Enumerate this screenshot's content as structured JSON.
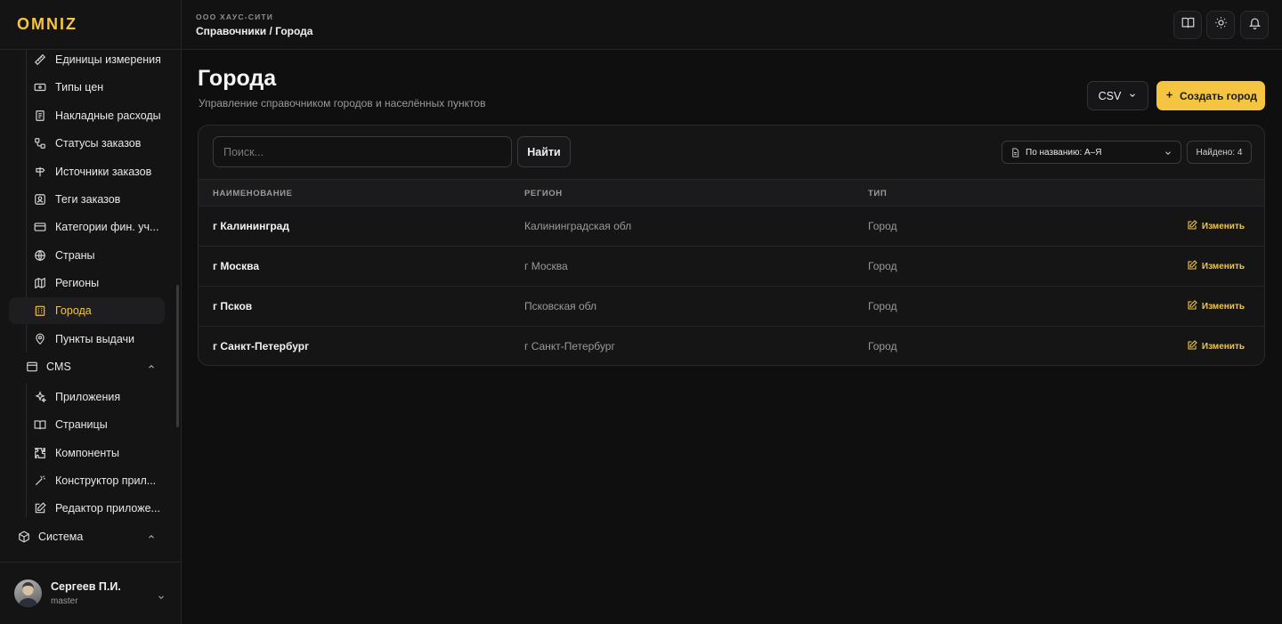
{
  "brand": {
    "logo_text": "OMNIZ",
    "accent": "#f5c542"
  },
  "sidebar": {
    "items": [
      {
        "label": "Единицы измерения",
        "icon": "ruler-icon"
      },
      {
        "label": "Типы цен",
        "icon": "banknote-icon"
      },
      {
        "label": "Накладные расходы",
        "icon": "receipt-icon"
      },
      {
        "label": "Статусы заказов",
        "icon": "workflow-icon"
      },
      {
        "label": "Источники заказов",
        "icon": "signpost-icon"
      },
      {
        "label": "Теги заказов",
        "icon": "tag-icon"
      },
      {
        "label": "Категории фин. уч...",
        "icon": "wallet-icon"
      },
      {
        "label": "Страны",
        "icon": "globe-icon"
      },
      {
        "label": "Регионы",
        "icon": "map-icon"
      },
      {
        "label": "Города",
        "icon": "building-icon",
        "active": true
      },
      {
        "label": "Пункты выдачи",
        "icon": "map-pin-icon"
      }
    ],
    "cms_group": "CMS",
    "cms_items": [
      {
        "label": "Приложения",
        "icon": "sparkles-icon"
      },
      {
        "label": "Страницы",
        "icon": "book-icon"
      },
      {
        "label": "Компоненты",
        "icon": "puzzle-icon"
      },
      {
        "label": "Конструктор прил...",
        "icon": "wand-icon"
      },
      {
        "label": "Редактор приложе...",
        "icon": "edit-icon"
      }
    ],
    "system_group": "Система"
  },
  "user": {
    "name": "Сергеев П.И.",
    "role": "master"
  },
  "topbar": {
    "org": "ООО ХАУС-СИТИ",
    "breadcrumb": "Справочники / Города"
  },
  "page": {
    "title": "Города",
    "subtitle": "Управление справочником городов и населённых пунктов",
    "csv_label": "CSV",
    "create_label": "Создать город"
  },
  "toolbar": {
    "search_placeholder": "Поиск...",
    "find_label": "Найти",
    "sort_label": "По названию: А–Я",
    "found_label": "Найдено: 4"
  },
  "table": {
    "headers": [
      "НАИМЕНОВАНИЕ",
      "РЕГИОН",
      "ТИП"
    ],
    "edit_label": "Изменить",
    "rows": [
      {
        "name": "г Калининград",
        "region": "Калининградская обл",
        "type": "Город"
      },
      {
        "name": "г Москва",
        "region": "г Москва",
        "type": "Город"
      },
      {
        "name": "г Псков",
        "region": "Псковская обл",
        "type": "Город"
      },
      {
        "name": "г Санкт-Петербург",
        "region": "г Санкт-Петербург",
        "type": "Город"
      }
    ]
  }
}
